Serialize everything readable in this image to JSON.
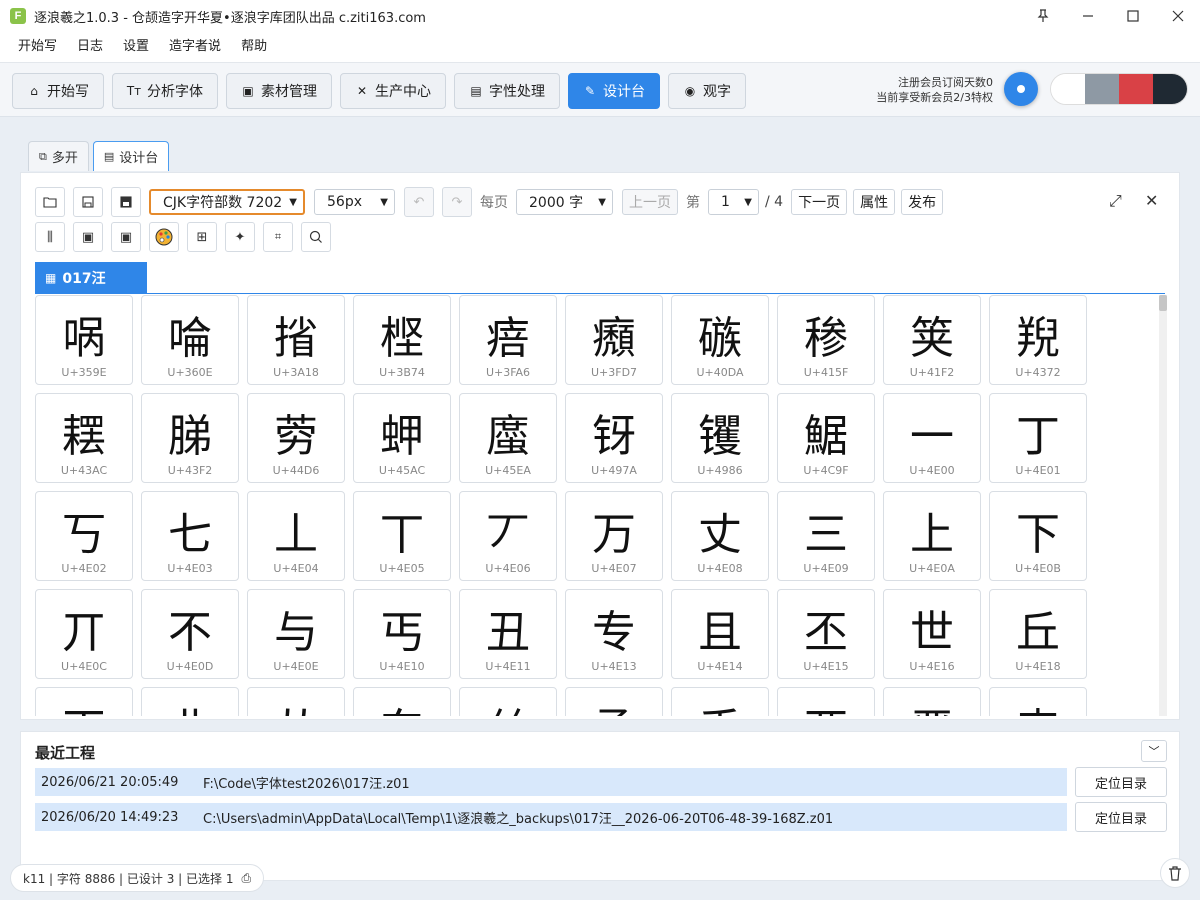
{
  "app": {
    "logo_letter": "F",
    "title": "逐浪羲之1.0.3 - 仓颉造字开华夏•逐浪字库团队出品 c.ziti163.com"
  },
  "menu": [
    "开始写",
    "日志",
    "设置",
    "造字者说",
    "帮助"
  ],
  "nav": [
    {
      "label": "开始写",
      "icon": "home-icon",
      "glyph": "⌂"
    },
    {
      "label": "分析字体",
      "icon": "text-icon",
      "glyph": "Tт"
    },
    {
      "label": "素材管理",
      "icon": "image-icon",
      "glyph": "▣"
    },
    {
      "label": "生产中心",
      "icon": "tools-icon",
      "glyph": "✕"
    },
    {
      "label": "字性处理",
      "icon": "document-icon",
      "glyph": "▤"
    },
    {
      "label": "设计台",
      "icon": "design-icon",
      "glyph": "✎"
    },
    {
      "label": "观字",
      "icon": "eye-icon",
      "glyph": "◉"
    }
  ],
  "member": {
    "line1": "注册会员订阅天数0",
    "line2": "当前享受新会员2/3特权"
  },
  "theme_colors": [
    "#ffffff",
    "#8e99a4",
    "#d94146",
    "#1f2933"
  ],
  "accent_color": "#2f86e8",
  "tabs": [
    {
      "label": "多开",
      "icon": "multi-open-icon"
    },
    {
      "label": "设计台",
      "icon": "design-doc-icon"
    }
  ],
  "toolbar": {
    "charset_select": "CJK字符部数 7202",
    "size_select": "56px",
    "per_page_label": "每页",
    "per_page_select": "2000 字",
    "prev_page": "上一页",
    "page_prefix": "第",
    "page_select": "1",
    "page_total": "/ 4",
    "next_page": "下一页",
    "properties": "属性",
    "publish": "发布"
  },
  "section_title": "017汪",
  "glyph_rows": [
    [
      {
        "char": "㖞",
        "code": "U+359E"
      },
      {
        "char": "㖮",
        "code": "U+360E"
      },
      {
        "char": "㨘",
        "code": "U+3A18"
      },
      {
        "char": "㭴",
        "code": "U+3B74"
      },
      {
        "char": "㾦",
        "code": "U+3FA6"
      },
      {
        "char": "㿗",
        "code": "U+3FD7"
      },
      {
        "char": "䃚",
        "code": "U+40DA"
      },
      {
        "char": "䅟",
        "code": "U+415F"
      },
      {
        "char": "䇲",
        "code": "U+41F2"
      },
      {
        "char": "䍲",
        "code": "U+4372"
      }
    ],
    [
      {
        "char": "䎬",
        "code": "U+43AC"
      },
      {
        "char": "䏲",
        "code": "U+43F2"
      },
      {
        "char": "䓖",
        "code": "U+44D6"
      },
      {
        "char": "䖬",
        "code": "U+45AC"
      },
      {
        "char": "䗪",
        "code": "U+45EA"
      },
      {
        "char": "䥺",
        "code": "U+497A"
      },
      {
        "char": "䦆",
        "code": "U+4986"
      },
      {
        "char": "䱟",
        "code": "U+4C9F"
      },
      {
        "char": "一",
        "code": "U+4E00"
      },
      {
        "char": "丁",
        "code": "U+4E01"
      }
    ],
    [
      {
        "char": "丂",
        "code": "U+4E02"
      },
      {
        "char": "七",
        "code": "U+4E03"
      },
      {
        "char": "丄",
        "code": "U+4E04"
      },
      {
        "char": "丅",
        "code": "U+4E05"
      },
      {
        "char": "丆",
        "code": "U+4E06"
      },
      {
        "char": "万",
        "code": "U+4E07"
      },
      {
        "char": "丈",
        "code": "U+4E08"
      },
      {
        "char": "三",
        "code": "U+4E09"
      },
      {
        "char": "上",
        "code": "U+4E0A"
      },
      {
        "char": "下",
        "code": "U+4E0B"
      }
    ],
    [
      {
        "char": "丌",
        "code": "U+4E0C"
      },
      {
        "char": "不",
        "code": "U+4E0D"
      },
      {
        "char": "与",
        "code": "U+4E0E"
      },
      {
        "char": "丐",
        "code": "U+4E10"
      },
      {
        "char": "丑",
        "code": "U+4E11"
      },
      {
        "char": "专",
        "code": "U+4E13"
      },
      {
        "char": "且",
        "code": "U+4E14"
      },
      {
        "char": "丕",
        "code": "U+4E15"
      },
      {
        "char": "世",
        "code": "U+4E16"
      },
      {
        "char": "丘",
        "code": "U+4E18"
      }
    ],
    [
      {
        "char": "丙",
        "code": ""
      },
      {
        "char": "业",
        "code": ""
      },
      {
        "char": "丛",
        "code": ""
      },
      {
        "char": "东",
        "code": ""
      },
      {
        "char": "丝",
        "code": ""
      },
      {
        "char": "丞",
        "code": ""
      },
      {
        "char": "丢",
        "code": ""
      },
      {
        "char": "两",
        "code": ""
      },
      {
        "char": "严",
        "code": ""
      },
      {
        "char": "丧",
        "code": ""
      }
    ]
  ],
  "recent": {
    "title": "最近工程",
    "items": [
      {
        "time": "2026/06/21 20:05:49",
        "path": "F:\\Code\\字体test2026\\017汪.z01",
        "button": "定位目录"
      },
      {
        "time": "2026/06/20 14:49:23",
        "path": "C:\\Users\\admin\\AppData\\Local\\Temp\\1\\逐浪羲之_backups\\017汪__2026-06-20T06-48-39-168Z.z01",
        "button": "定位目录"
      }
    ]
  },
  "status": {
    "text": "k11 | 字符 8886 | 已设计 3 | 已选择 1"
  }
}
